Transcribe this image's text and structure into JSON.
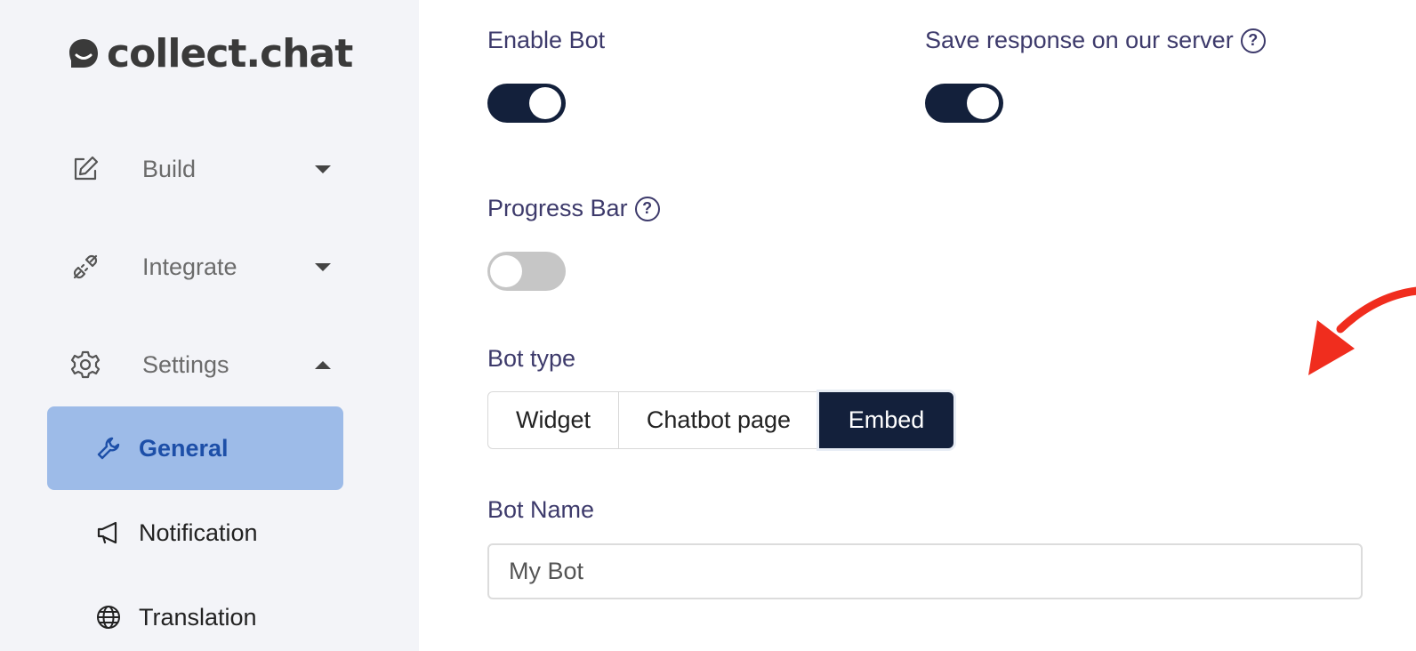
{
  "logo": {
    "text": "collect.chat"
  },
  "sidebar": {
    "items": [
      {
        "label": "Build",
        "icon": "edit-icon",
        "caret": "down"
      },
      {
        "label": "Integrate",
        "icon": "plug-icon",
        "caret": "down"
      },
      {
        "label": "Settings",
        "icon": "gear-icon",
        "caret": "up"
      }
    ],
    "sub_items": [
      {
        "label": "General",
        "icon": "wrench-icon",
        "active": true
      },
      {
        "label": "Notification",
        "icon": "megaphone-icon",
        "active": false
      },
      {
        "label": "Translation",
        "icon": "globe-icon",
        "active": false
      }
    ]
  },
  "settings": {
    "enable_bot": {
      "label": "Enable Bot",
      "on": true
    },
    "save_response": {
      "label": "Save response on our server",
      "on": true,
      "help": "?"
    },
    "progress_bar": {
      "label": "Progress Bar",
      "on": false,
      "help": "?"
    },
    "bot_type": {
      "label": "Bot type",
      "options": [
        "Widget",
        "Chatbot page",
        "Embed"
      ],
      "selected": "Embed"
    },
    "bot_name": {
      "label": "Bot Name",
      "value": "My Bot"
    }
  },
  "colors": {
    "accent_dark": "#13203b",
    "sidebar_active": "#9dbbe8",
    "annotation_arrow": "#f02d1e"
  }
}
